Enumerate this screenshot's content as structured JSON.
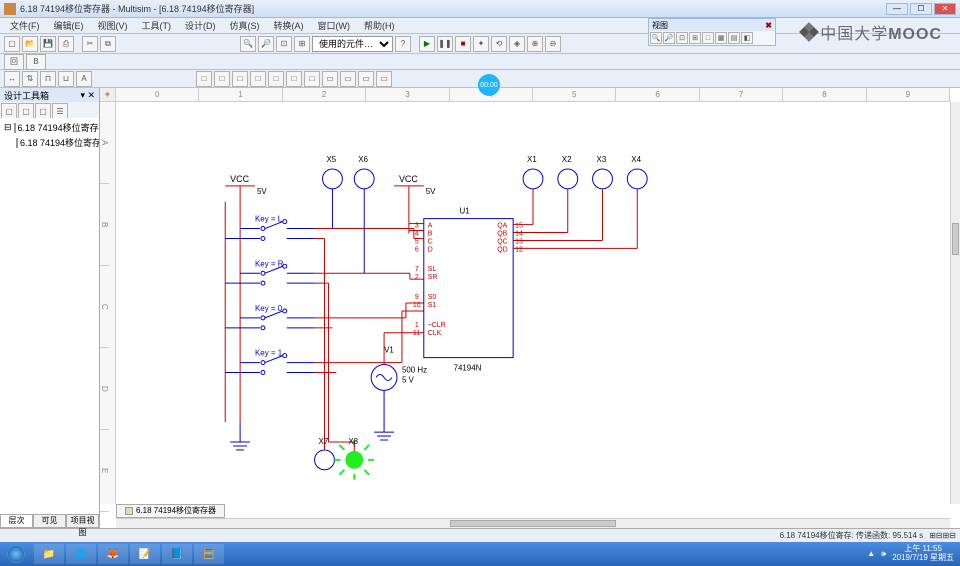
{
  "window": {
    "title": "6.18 74194移位寄存器 - Multisim - [6.18 74194移位寄存器]",
    "min": "—",
    "max": "☐",
    "close": "✕"
  },
  "menu": [
    "文件(F)",
    "编辑(E)",
    "视图(V)",
    "工具(T)",
    "设计(D)",
    "仿真(S)",
    "转换(A)",
    "窗口(W)",
    "帮助(H)"
  ],
  "toolbar": {
    "dropdown": "使用的元件…",
    "sim_run": "▶",
    "sim_pause": "❚❚",
    "sim_stop": "■"
  },
  "floatpanel": {
    "title": "视图",
    "close": "✖"
  },
  "sidebar": {
    "title": "设计工具箱",
    "items": [
      "6.18 74194移位寄存器",
      "6.18 74194移位寄存器"
    ],
    "tabs": [
      "层次",
      "可见",
      "项目视图"
    ]
  },
  "ruler_h": [
    "0",
    "1",
    "2",
    "3",
    "4",
    "5",
    "6",
    "7",
    "8",
    "9"
  ],
  "ruler_v": [
    "A",
    "B",
    "C",
    "D",
    "E"
  ],
  "circuit": {
    "vcc": "VCC",
    "v5": "5V",
    "keys": [
      "Key = L",
      "Key = R",
      "Key = 0",
      "Key = 1"
    ],
    "probes_top": [
      "X5",
      "X6"
    ],
    "probes_right": [
      "X1",
      "X2",
      "X3",
      "X4"
    ],
    "probes_bot": [
      "X7",
      "X8"
    ],
    "ic": {
      "ref": "U1",
      "name": "74194N",
      "left_pins": [
        "A",
        "B",
        "C",
        "D",
        "SL",
        "SR",
        "S0",
        "S1",
        "~CLR",
        "CLK"
      ],
      "left_nums": [
        "3",
        "4",
        "5",
        "6",
        "7",
        "2",
        "9",
        "10",
        "1",
        "11"
      ],
      "right_pins": [
        "QA",
        "QB",
        "QC",
        "QD"
      ],
      "right_nums": [
        "15",
        "14",
        "13",
        "12"
      ]
    },
    "src": {
      "ref": "V1",
      "freq": "500 Hz",
      "amp": "5 V"
    }
  },
  "bottom_tab": "6.18 74194移位寄存器",
  "status": {
    "left": "6.18 74194移位寄存: 传递函数: 95.514 s",
    "grid": "⊞⊟⊞⊟"
  },
  "playbadge": "00:00",
  "watermark": "中国大学MOOC",
  "taskbar": {
    "icons": [
      "📁",
      "🌐",
      "🦊",
      "📝",
      "📘",
      "🧮"
    ],
    "clock_top": "上午 11:55",
    "clock_bot": "2019/7/19 星期五"
  }
}
